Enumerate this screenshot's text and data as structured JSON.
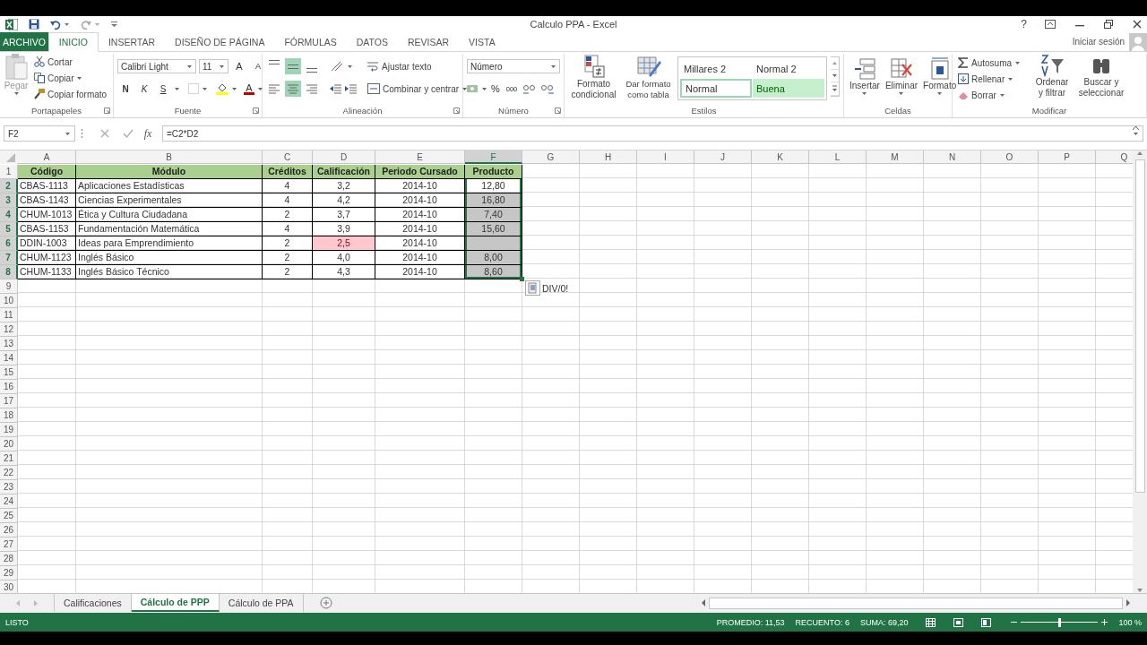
{
  "title_bar": {
    "title": "Calculo PPA - Excel",
    "help": "?"
  },
  "ribbon_tabs": [
    {
      "label": "ARCHIVO",
      "kind": "file",
      "selected": false
    },
    {
      "label": "INICIO",
      "kind": "tab",
      "selected": true
    },
    {
      "label": "INSERTAR",
      "kind": "tab",
      "selected": false
    },
    {
      "label": "DISEÑO DE PÁGINA",
      "kind": "tab",
      "selected": false
    },
    {
      "label": "FÓRMULAS",
      "kind": "tab",
      "selected": false
    },
    {
      "label": "DATOS",
      "kind": "tab",
      "selected": false
    },
    {
      "label": "REVISAR",
      "kind": "tab",
      "selected": false
    },
    {
      "label": "VISTA",
      "kind": "tab",
      "selected": false
    }
  ],
  "account": {
    "label": "Iniciar sesión"
  },
  "ribbon": {
    "clipboard": {
      "label": "Portapapeles",
      "paste": "Pegar",
      "items": [
        "Cortar",
        "Copiar",
        "Copiar formato"
      ]
    },
    "font": {
      "label": "Fuente",
      "font": "Calibri Light",
      "size": "11",
      "grow": "A",
      "shrink": "A",
      "bold": "N",
      "italic": "K",
      "underline": "S",
      "font_color_label": "A"
    },
    "alignment": {
      "label": "Alineación",
      "vertical": [
        {
          "selected": false
        },
        {
          "selected": true
        },
        {
          "selected": false
        }
      ],
      "horizontal": [
        {
          "selected": false
        },
        {
          "selected": true
        },
        {
          "selected": false
        }
      ],
      "wrap": "Ajustar texto",
      "merge": "Combinar y centrar"
    },
    "number": {
      "label": "Número",
      "format": "Número",
      "percent": "%",
      "thousands": "000"
    },
    "styles": {
      "label": "Estilos",
      "conditional": "Formato condicional",
      "table": "Dar formato como tabla",
      "gallery": [
        {
          "label": "Millares 2",
          "kind": "plain"
        },
        {
          "label": "Normal 2",
          "kind": "plain"
        },
        {
          "label": "Normal",
          "kind": "normal"
        },
        {
          "label": "Buena",
          "kind": "good"
        }
      ]
    },
    "cells": {
      "label": "Celdas",
      "buttons": [
        "Insertar",
        "Eliminar",
        "Formato"
      ]
    },
    "editing": {
      "label": "Modificar",
      "items": [
        "Autosuma",
        "Rellenar",
        "Borrar"
      ],
      "sort": "Ordenar y filtrar",
      "find": "Buscar y seleccionar"
    }
  },
  "formula_bar": {
    "name_box": "F2",
    "fx": "fx",
    "formula": "=C2*D2"
  },
  "sheet": {
    "columns": [
      {
        "label": "A",
        "selected": false
      },
      {
        "label": "B",
        "selected": false
      },
      {
        "label": "C",
        "selected": false
      },
      {
        "label": "D",
        "selected": false
      },
      {
        "label": "E",
        "selected": false
      },
      {
        "label": "F",
        "selected": true
      },
      {
        "label": "G",
        "selected": false
      },
      {
        "label": "H",
        "selected": false
      },
      {
        "label": "I",
        "selected": false
      },
      {
        "label": "J",
        "selected": false
      },
      {
        "label": "K",
        "selected": false
      },
      {
        "label": "L",
        "selected": false
      },
      {
        "label": "M",
        "selected": false
      },
      {
        "label": "N",
        "selected": false
      },
      {
        "label": "O",
        "selected": false
      },
      {
        "label": "P",
        "selected": false
      },
      {
        "label": "Q",
        "selected": false
      }
    ],
    "rows": [
      {
        "number": "1",
        "selected": false,
        "cells": [
          {
            "text": "Código",
            "kind": "header"
          },
          {
            "text": "Módulo",
            "kind": "header"
          },
          {
            "text": "Créditos",
            "kind": "header"
          },
          {
            "text": "Calificación",
            "kind": "header"
          },
          {
            "text": "Periodo Cursado",
            "kind": "header"
          },
          {
            "text": "Producto",
            "kind": "header"
          }
        ]
      },
      {
        "number": "2",
        "selected": true,
        "cells": [
          {
            "text": "CBAS-1113",
            "kind": "text"
          },
          {
            "text": "Aplicaciones Estadísticas",
            "kind": "text"
          },
          {
            "text": "4",
            "kind": "number"
          },
          {
            "text": "3,2",
            "kind": "number"
          },
          {
            "text": "2014-10",
            "kind": "number"
          },
          {
            "text": "12,80",
            "kind": "active"
          }
        ]
      },
      {
        "number": "3",
        "selected": true,
        "cells": [
          {
            "text": "CBAS-1143",
            "kind": "text"
          },
          {
            "text": "Ciencias Experimentales",
            "kind": "text"
          },
          {
            "text": "4",
            "kind": "number"
          },
          {
            "text": "4,2",
            "kind": "number"
          },
          {
            "text": "2014-10",
            "kind": "number"
          },
          {
            "text": "16,80",
            "kind": "selected"
          }
        ]
      },
      {
        "number": "4",
        "selected": true,
        "cells": [
          {
            "text": "CHUM-1013",
            "kind": "text"
          },
          {
            "text": "Ética y Cultura Ciudadana",
            "kind": "text"
          },
          {
            "text": "2",
            "kind": "number"
          },
          {
            "text": "3,7",
            "kind": "number"
          },
          {
            "text": "2014-10",
            "kind": "number"
          },
          {
            "text": "7,40",
            "kind": "selected"
          }
        ]
      },
      {
        "number": "5",
        "selected": true,
        "cells": [
          {
            "text": "CBAS-1153",
            "kind": "text"
          },
          {
            "text": "Fundamentación Matemática",
            "kind": "text"
          },
          {
            "text": "4",
            "kind": "number"
          },
          {
            "text": "3,9",
            "kind": "number"
          },
          {
            "text": "2014-10",
            "kind": "number"
          },
          {
            "text": "15,60",
            "kind": "selected"
          }
        ]
      },
      {
        "number": "6",
        "selected": true,
        "cells": [
          {
            "text": "DDIN-1003",
            "kind": "text"
          },
          {
            "text": "Ideas para Emprendimiento",
            "kind": "text"
          },
          {
            "text": "2",
            "kind": "number"
          },
          {
            "text": "2,5",
            "kind": "bad"
          },
          {
            "text": "2014-10",
            "kind": "number"
          },
          {
            "kind": "selected"
          }
        ]
      },
      {
        "number": "7",
        "selected": true,
        "cells": [
          {
            "text": "CHUM-1123",
            "kind": "text"
          },
          {
            "text": "Inglés Básico",
            "kind": "text"
          },
          {
            "text": "2",
            "kind": "number"
          },
          {
            "text": "4,0",
            "kind": "number"
          },
          {
            "text": "2014-10",
            "kind": "number"
          },
          {
            "text": "8,00",
            "kind": "selected"
          }
        ]
      },
      {
        "number": "8",
        "selected": true,
        "cells": [
          {
            "text": "CHUM-1133",
            "kind": "text"
          },
          {
            "text": "Inglés Básico Técnico",
            "kind": "text"
          },
          {
            "text": "2",
            "kind": "number"
          },
          {
            "text": "4,3",
            "kind": "number"
          },
          {
            "text": "2014-10",
            "kind": "number"
          },
          {
            "text": "8,60",
            "kind": "last"
          }
        ]
      },
      {
        "number": "9",
        "selected": false
      },
      {
        "number": "10",
        "selected": false
      },
      {
        "number": "11",
        "selected": false
      },
      {
        "number": "12",
        "selected": false
      },
      {
        "number": "13",
        "selected": false
      },
      {
        "number": "14",
        "selected": false
      },
      {
        "number": "15",
        "selected": false
      },
      {
        "number": "16",
        "selected": false
      },
      {
        "number": "17",
        "selected": false
      },
      {
        "number": "18",
        "selected": false
      },
      {
        "number": "19",
        "selected": false
      },
      {
        "number": "20",
        "selected": false
      },
      {
        "number": "21",
        "selected": false
      },
      {
        "number": "22",
        "selected": false
      },
      {
        "number": "23",
        "selected": false
      },
      {
        "number": "24",
        "selected": false
      },
      {
        "number": "25",
        "selected": false
      },
      {
        "number": "26",
        "selected": false
      },
      {
        "number": "27",
        "selected": false
      },
      {
        "number": "28",
        "selected": false
      },
      {
        "number": "29",
        "selected": false
      },
      {
        "number": "30",
        "selected": false
      }
    ],
    "smart_tag": {
      "text": "DIV/0!"
    }
  },
  "sheet_tabs": [
    {
      "label": "Calificaciones",
      "selected": false
    },
    {
      "label": "Cálculo de PPP",
      "selected": true
    },
    {
      "label": "Cálculo de PPA",
      "selected": false
    }
  ],
  "status_bar": {
    "mode": "LISTO",
    "stats": [
      "PROMEDIO: 11,53",
      "RECUENTO: 6",
      "SUMA: 69,20"
    ],
    "zoom": "100 %",
    "level": 0.5
  }
}
